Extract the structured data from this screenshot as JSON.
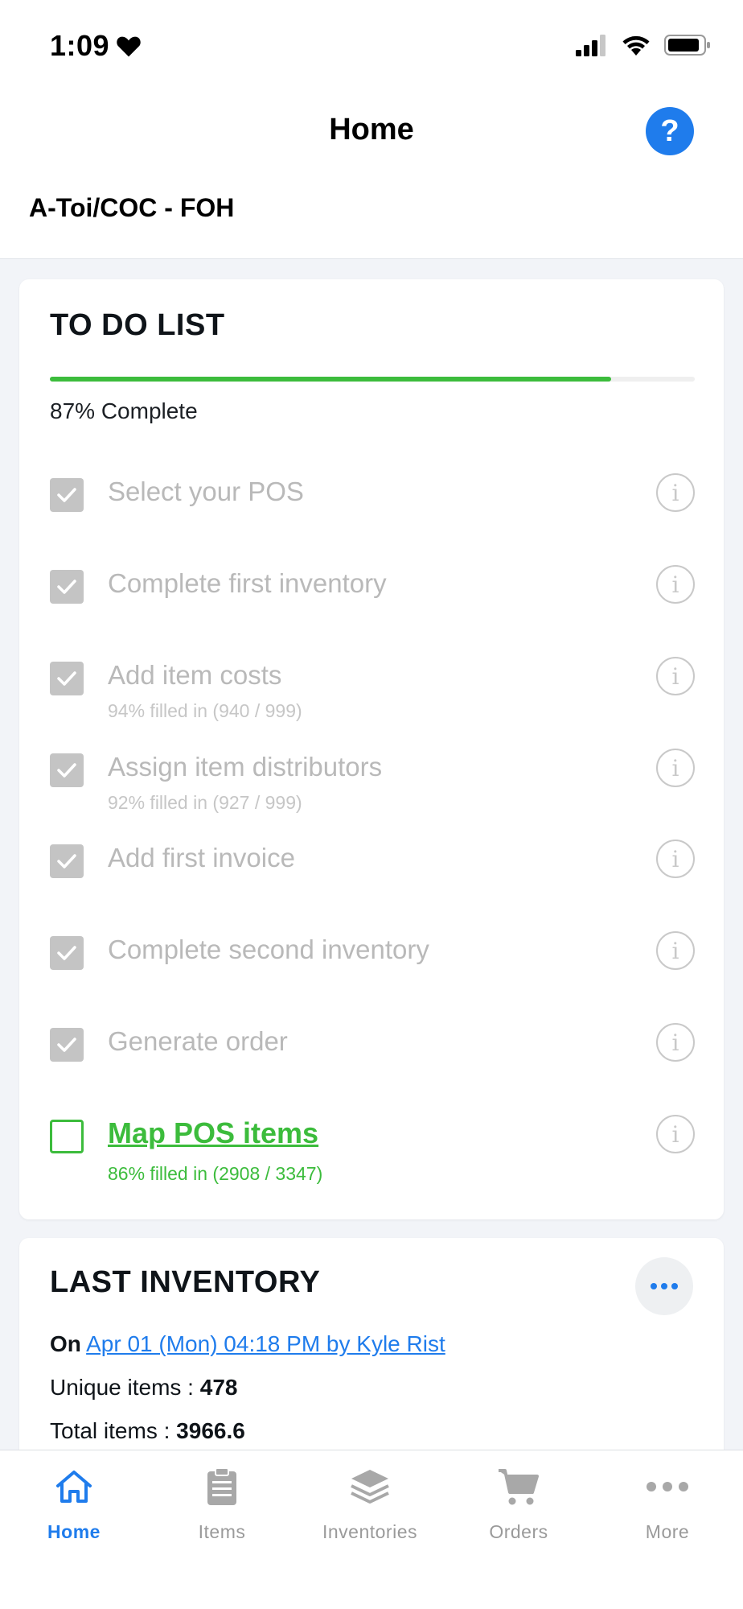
{
  "status": {
    "time": "1:09"
  },
  "header": {
    "title": "Home",
    "help": "?",
    "location": "A-Toi/COC - FOH"
  },
  "todo": {
    "title": "TO DO LIST",
    "progress": 87,
    "progress_text": "87% Complete",
    "items": [
      {
        "label": "Select your POS",
        "sub": ""
      },
      {
        "label": "Complete first inventory",
        "sub": ""
      },
      {
        "label": "Add item costs",
        "sub": "94% filled in (940 / 999)"
      },
      {
        "label": "Assign item distributors",
        "sub": "92% filled in (927 / 999)"
      },
      {
        "label": "Add first invoice",
        "sub": ""
      },
      {
        "label": "Complete second inventory",
        "sub": ""
      },
      {
        "label": "Generate order",
        "sub": ""
      },
      {
        "label": "Map POS items",
        "sub": "86% filled in (2908 / 3347)"
      }
    ],
    "info_symbol": "i"
  },
  "last_inventory": {
    "title": "LAST INVENTORY",
    "on_prefix": "On",
    "link": "Apr 01 (Mon) 04:18 PM by Kyle Rist",
    "unique_label": "Unique items : ",
    "unique_value": "478",
    "total_label": "Total items : ",
    "total_value": "3966.6"
  },
  "tabbar": {
    "tabs": [
      {
        "label": "Home",
        "icon": "home-icon"
      },
      {
        "label": "Items",
        "icon": "clipboard-icon"
      },
      {
        "label": "Inventories",
        "icon": "layers-icon"
      },
      {
        "label": "Orders",
        "icon": "cart-icon"
      },
      {
        "label": "More",
        "icon": "more-icon"
      }
    ]
  },
  "colors": {
    "accent": "#1f7cec",
    "success": "#3cbc3c",
    "muted": "#b9b9b9"
  }
}
